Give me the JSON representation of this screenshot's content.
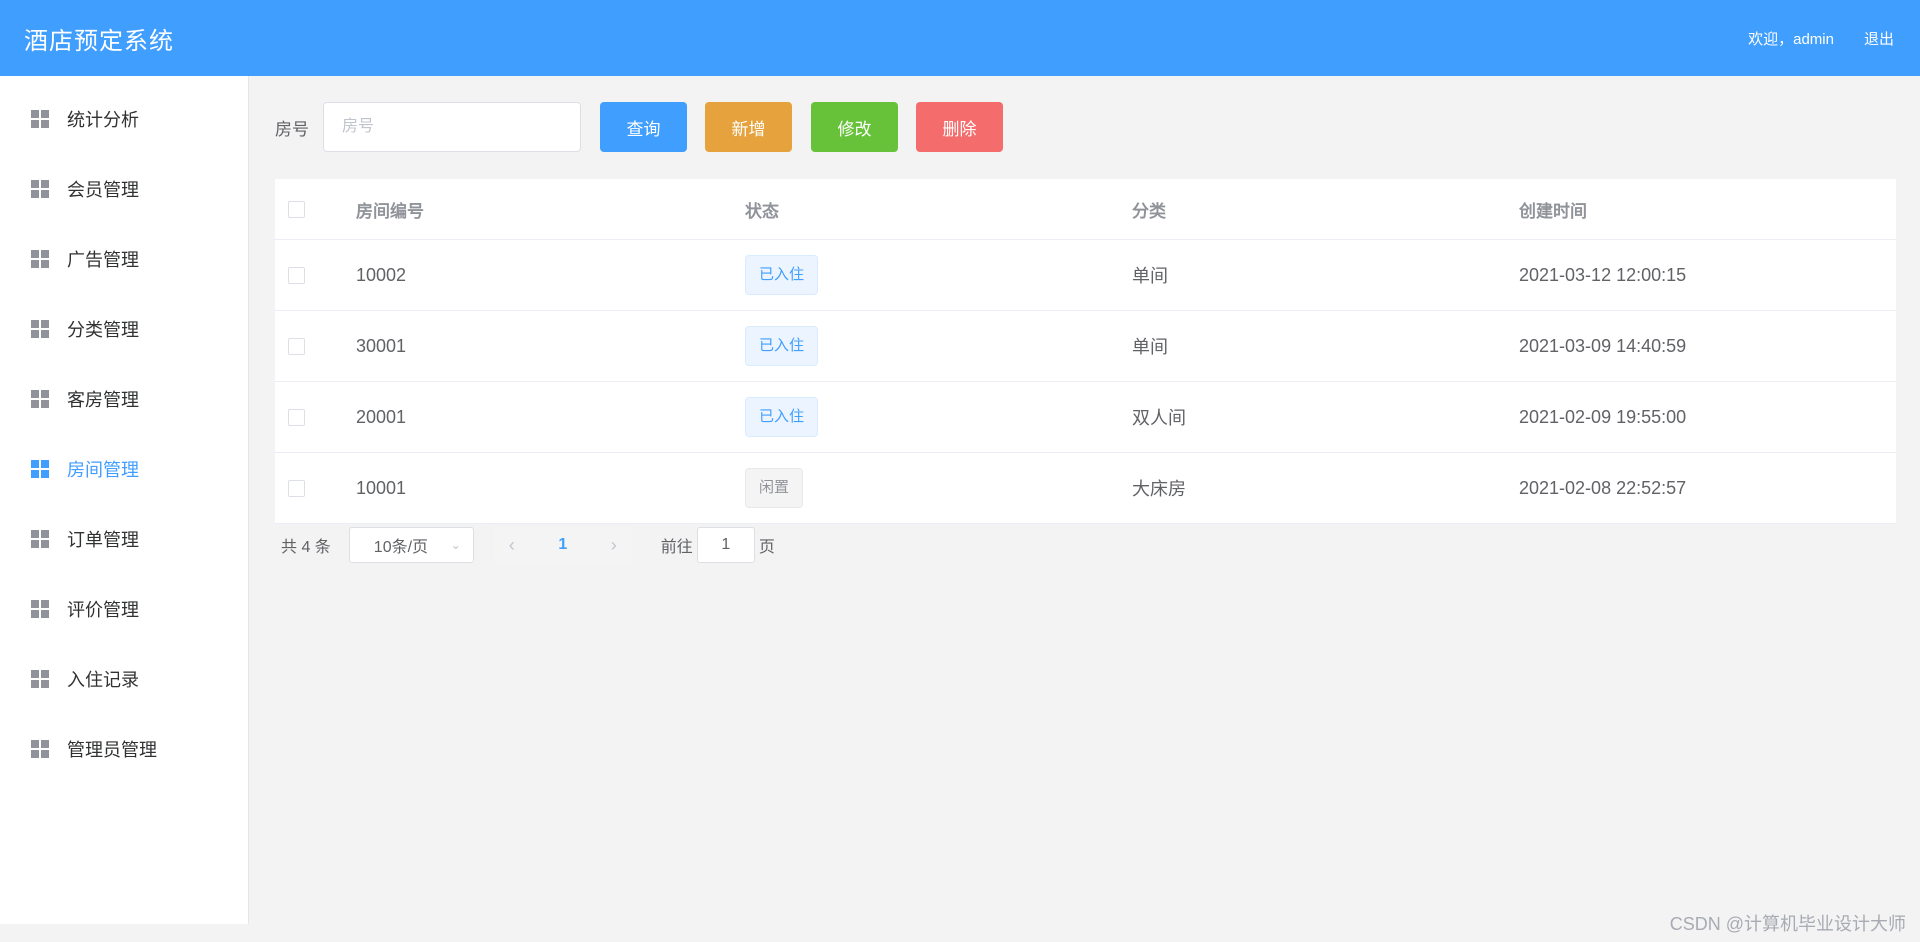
{
  "header": {
    "title": "酒店预定系统",
    "welcome": "欢迎，admin",
    "logout": "退出"
  },
  "sidebar": {
    "items": [
      {
        "label": "统计分析"
      },
      {
        "label": "会员管理"
      },
      {
        "label": "广告管理"
      },
      {
        "label": "分类管理"
      },
      {
        "label": "客房管理"
      },
      {
        "label": "房间管理",
        "active": true
      },
      {
        "label": "订单管理"
      },
      {
        "label": "评价管理"
      },
      {
        "label": "入住记录"
      },
      {
        "label": "管理员管理"
      }
    ]
  },
  "search": {
    "label": "房号",
    "placeholder": "房号",
    "value": ""
  },
  "buttons": {
    "query": "查询",
    "add": "新增",
    "edit": "修改",
    "delete": "删除"
  },
  "table": {
    "columns": [
      "房间编号",
      "状态",
      "分类",
      "创建时间"
    ],
    "rows": [
      {
        "room_no": "10002",
        "status": "已入住",
        "category": "单间",
        "created": "2021-03-12 12:00:15"
      },
      {
        "room_no": "30001",
        "status": "已入住",
        "category": "单间",
        "created": "2021-03-09 14:40:59"
      },
      {
        "room_no": "20001",
        "status": "已入住",
        "category": "双人间",
        "created": "2021-02-09 19:55:00"
      },
      {
        "room_no": "10001",
        "status": "闲置",
        "category": "大床房",
        "created": "2021-02-08 22:52:57"
      }
    ]
  },
  "pagination": {
    "total": "共 4 条",
    "page_size": "10条/页",
    "current_page": "1",
    "goto_prefix": "前往",
    "goto_value": "1",
    "goto_suffix": "页"
  },
  "watermark": "CSDN @计算机毕业设计大师",
  "colors": {
    "primary": "#409eff",
    "warning": "#e6a23c",
    "success": "#67c23a",
    "danger": "#f56c6c"
  }
}
